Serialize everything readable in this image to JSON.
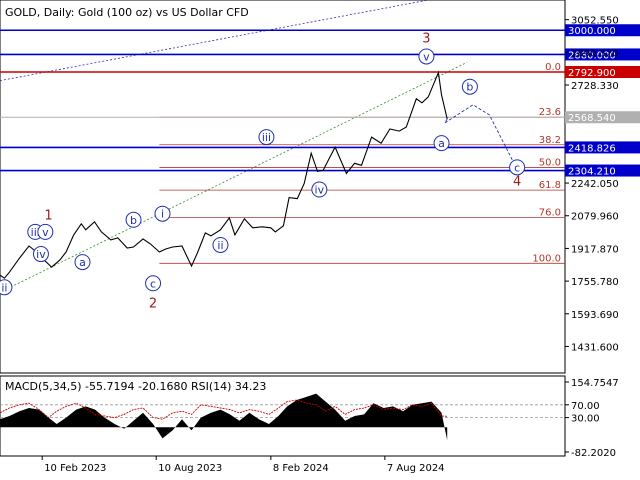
{
  "header": {
    "title": "GOLD, Daily:  Gold (100 oz) vs US Dollar CFD"
  },
  "colors": {
    "background": "#ffffff",
    "price_line": "#000000",
    "blue_level": "#0000cc",
    "red_level": "#cc0000",
    "fib_line": "#b03a2e",
    "wave_label_blue": "#1f2fb0",
    "wave_label_red": "#9b1b1b",
    "gray_level": "#b0b0b0",
    "channel_green": "#2e8b2e",
    "channel_purple": "#3b2bb3",
    "projection_blue": "#1f2fb0",
    "projection_red": "#cc0000",
    "macd_fill": "#000000",
    "rsi_line": "#cc0000"
  },
  "chart_data": [
    {
      "type": "line",
      "panel": "price",
      "ylim": [
        1300,
        3150
      ],
      "xlim": [
        "2022-12-05",
        "2025-05-20"
      ],
      "price_axis_ticks": [
        "3052.550",
        "2890.520",
        "2728.330",
        "2242.050",
        "2079.960",
        "1917.870",
        "1755.780",
        "1593.690",
        "1431.600"
      ],
      "x_axis_ticks": [
        {
          "date": "2023-02-10",
          "label": "10 Feb 2023"
        },
        {
          "date": "2023-08-10",
          "label": "10 Aug 2023"
        },
        {
          "date": "2024-02-08",
          "label": "8 Feb 2024"
        },
        {
          "date": "2024-08-07",
          "label": "7 Aug 2024"
        }
      ],
      "series": [
        {
          "x": [
            "2022-12-05",
            "2022-12-12",
            "2022-12-20",
            "2023-01-05",
            "2023-01-20",
            "2023-02-01",
            "2023-02-10",
            "2023-02-25",
            "2023-03-10",
            "2023-03-20",
            "2023-04-01",
            "2023-04-13",
            "2023-04-20",
            "2023-05-04",
            "2023-05-15",
            "2023-05-30",
            "2023-06-10",
            "2023-06-25",
            "2023-07-05",
            "2023-07-20",
            "2023-08-01",
            "2023-08-15",
            "2023-08-25",
            "2023-09-05",
            "2023-09-20",
            "2023-10-05",
            "2023-10-15",
            "2023-10-27",
            "2023-11-05",
            "2023-11-20",
            "2023-12-04",
            "2023-12-13",
            "2023-12-28",
            "2024-01-10",
            "2024-01-25",
            "2024-02-08",
            "2024-02-15",
            "2024-02-28",
            "2024-03-08",
            "2024-03-21",
            "2024-04-01",
            "2024-04-12",
            "2024-04-22",
            "2024-05-01",
            "2024-05-10",
            "2024-05-20",
            "2024-06-07",
            "2024-06-20",
            "2024-07-01",
            "2024-07-17",
            "2024-08-01",
            "2024-08-15",
            "2024-08-30",
            "2024-09-10",
            "2024-09-26",
            "2024-10-05",
            "2024-10-15",
            "2024-10-31",
            "2024-11-05",
            "2024-11-14"
          ],
          "values": [
            1785,
            1770,
            1800,
            1870,
            1930,
            1900,
            1870,
            1825,
            1860,
            1900,
            1985,
            2040,
            2010,
            2050,
            2000,
            1960,
            1970,
            1920,
            1925,
            1965,
            1940,
            1900,
            1915,
            1925,
            1930,
            1830,
            1900,
            1995,
            1980,
            2010,
            2070,
            1985,
            2065,
            2020,
            2025,
            2020,
            2000,
            2030,
            2170,
            2165,
            2240,
            2390,
            2300,
            2305,
            2360,
            2420,
            2290,
            2340,
            2330,
            2470,
            2440,
            2510,
            2500,
            2520,
            2660,
            2640,
            2670,
            2790,
            2680,
            2560
          ]
        }
      ],
      "levels": {
        "blue": [
          {
            "label": "3000.000",
            "value": 3000.0
          },
          {
            "label": "2880.000",
            "value": 2880.0
          },
          {
            "label": "2418.826",
            "value": 2418.826
          },
          {
            "label": "2304.210",
            "value": 2304.21
          }
        ],
        "red": [
          {
            "label": "2792.900",
            "value": 2792.9
          }
        ],
        "current_price": {
          "label": "2568.540",
          "value": 2568.54
        }
      },
      "fibonacci": [
        {
          "label": "0.0",
          "value": 2792.9
        },
        {
          "label": "23.6",
          "value": 2568.54
        },
        {
          "label": "38.2",
          "value": 2432
        },
        {
          "label": "50.0",
          "value": 2319
        },
        {
          "label": "61.8",
          "value": 2207
        },
        {
          "label": "76.0",
          "value": 2072
        },
        {
          "label": "100.0",
          "value": 1844
        }
      ],
      "wave_labels": [
        {
          "text": "ii",
          "date": "2022-12-12",
          "value": 1725,
          "style": "circle"
        },
        {
          "text": "iii",
          "date": "2023-01-30",
          "value": 2000,
          "style": "circle"
        },
        {
          "text": "v",
          "date": "2023-02-15",
          "value": 2000,
          "style": "circle"
        },
        {
          "text": "iv",
          "date": "2023-02-08",
          "value": 1890,
          "style": "circle"
        },
        {
          "text": "1",
          "date": "2023-02-20",
          "value": 2080,
          "style": "red"
        },
        {
          "text": "a",
          "date": "2023-04-15",
          "value": 1850,
          "style": "circle"
        },
        {
          "text": "b",
          "date": "2023-07-05",
          "value": 2060,
          "style": "circle"
        },
        {
          "text": "c",
          "date": "2023-08-05",
          "value": 1745,
          "style": "circle"
        },
        {
          "text": "2",
          "date": "2023-08-05",
          "value": 1645,
          "style": "red"
        },
        {
          "text": "i",
          "date": "2023-08-20",
          "value": 2090,
          "style": "circle"
        },
        {
          "text": "ii",
          "date": "2023-11-20",
          "value": 1935,
          "style": "circle"
        },
        {
          "text": "iii",
          "date": "2024-02-01",
          "value": 2470,
          "style": "circle"
        },
        {
          "text": "iv",
          "date": "2024-04-25",
          "value": 2210,
          "style": "circle"
        },
        {
          "text": "v",
          "date": "2024-10-12",
          "value": 2870,
          "style": "circle"
        },
        {
          "text": "3",
          "date": "2024-10-12",
          "value": 2960,
          "style": "red"
        },
        {
          "text": "a",
          "date": "2024-11-05",
          "value": 2440,
          "style": "circle"
        },
        {
          "text": "b",
          "date": "2024-12-20",
          "value": 2720,
          "style": "circle"
        },
        {
          "text": "c",
          "date": "2025-03-05",
          "value": 2320,
          "style": "circle"
        },
        {
          "text": "4",
          "date": "2025-03-05",
          "value": 2250,
          "style": "red"
        }
      ],
      "projection": [
        {
          "date": "2024-11-10",
          "value": 2540
        },
        {
          "date": "2024-12-25",
          "value": 2630
        },
        {
          "date": "2025-01-20",
          "value": 2580
        },
        {
          "date": "2025-03-05",
          "value": 2310
        }
      ]
    },
    {
      "type": "area",
      "panel": "indicator",
      "title": "MACD(5,34,5) -55.7194 -20.1680 RSI(14) 34.23",
      "ylim": [
        -90,
        160
      ],
      "axis_ticks": [
        "154.7547",
        "70.00",
        "30.00",
        "-82.2020"
      ],
      "levels": [
        {
          "label": "70.00",
          "value": 70
        },
        {
          "label": "30.00",
          "value": 30
        }
      ],
      "macd_series": {
        "x": [
          "2022-12-05",
          "2022-12-20",
          "2023-01-05",
          "2023-01-20",
          "2023-02-05",
          "2023-02-20",
          "2023-03-05",
          "2023-03-20",
          "2023-04-05",
          "2023-04-20",
          "2023-05-05",
          "2023-05-20",
          "2023-06-05",
          "2023-06-20",
          "2023-07-05",
          "2023-07-20",
          "2023-08-05",
          "2023-08-20",
          "2023-09-05",
          "2023-09-20",
          "2023-10-05",
          "2023-10-20",
          "2023-11-05",
          "2023-11-20",
          "2023-12-05",
          "2023-12-20",
          "2024-01-05",
          "2024-01-20",
          "2024-02-05",
          "2024-02-20",
          "2024-03-05",
          "2024-03-20",
          "2024-04-05",
          "2024-04-20",
          "2024-05-05",
          "2024-05-20",
          "2024-06-05",
          "2024-06-20",
          "2024-07-05",
          "2024-07-20",
          "2024-08-05",
          "2024-08-20",
          "2024-09-05",
          "2024-09-20",
          "2024-10-05",
          "2024-10-20",
          "2024-11-05",
          "2024-11-14"
        ],
        "values": [
          25,
          35,
          50,
          60,
          55,
          30,
          10,
          30,
          55,
          65,
          55,
          30,
          10,
          -5,
          20,
          45,
          10,
          -35,
          -10,
          25,
          -10,
          30,
          45,
          55,
          40,
          20,
          45,
          25,
          10,
          35,
          65,
          85,
          95,
          105,
          80,
          55,
          20,
          35,
          40,
          75,
          60,
          65,
          50,
          70,
          75,
          80,
          45,
          -40
        ]
      },
      "rsi_series": {
        "x": [
          "2022-12-05",
          "2022-12-20",
          "2023-01-05",
          "2023-01-20",
          "2023-02-05",
          "2023-02-20",
          "2023-03-05",
          "2023-03-20",
          "2023-04-05",
          "2023-04-20",
          "2023-05-05",
          "2023-05-20",
          "2023-06-05",
          "2023-06-20",
          "2023-07-05",
          "2023-07-20",
          "2023-08-05",
          "2023-08-20",
          "2023-09-05",
          "2023-09-20",
          "2023-10-05",
          "2023-10-20",
          "2023-11-05",
          "2023-11-20",
          "2023-12-05",
          "2023-12-20",
          "2024-01-05",
          "2024-01-20",
          "2024-02-05",
          "2024-02-20",
          "2024-03-05",
          "2024-03-20",
          "2024-04-05",
          "2024-04-20",
          "2024-05-05",
          "2024-05-20",
          "2024-06-05",
          "2024-06-20",
          "2024-07-05",
          "2024-07-20",
          "2024-08-05",
          "2024-08-20",
          "2024-09-05",
          "2024-09-20",
          "2024-10-05",
          "2024-10-20",
          "2024-11-05",
          "2024-11-14"
        ],
        "values": [
          45,
          60,
          70,
          75,
          55,
          30,
          50,
          65,
          75,
          60,
          40,
          35,
          30,
          40,
          55,
          60,
          30,
          25,
          45,
          50,
          40,
          70,
          65,
          60,
          55,
          45,
          55,
          50,
          40,
          60,
          80,
          85,
          75,
          70,
          50,
          65,
          40,
          55,
          60,
          70,
          55,
          60,
          55,
          70,
          65,
          75,
          35,
          34
        ]
      }
    }
  ]
}
